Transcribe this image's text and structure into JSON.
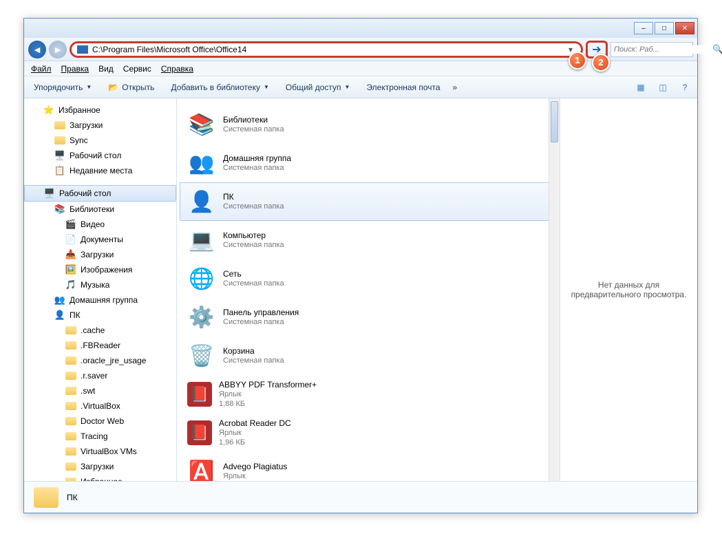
{
  "titlebar": {
    "min": "–",
    "max": "□",
    "close": "✕"
  },
  "address": {
    "path": "C:\\Program Files\\Microsoft Office\\Office14"
  },
  "callouts": {
    "one": "1",
    "two": "2"
  },
  "search": {
    "placeholder": "Поиск: Раб..."
  },
  "menu": {
    "file": "Файл",
    "edit": "Правка",
    "view": "Вид",
    "tools": "Сервис",
    "help": "Справка"
  },
  "toolbar": {
    "organize": "Упорядочить",
    "open": "Открыть",
    "addlib": "Добавить в библиотеку",
    "share": "Общий доступ",
    "email": "Электронная почта"
  },
  "nav": {
    "favorites": "Избранное",
    "downloads": "Загрузки",
    "sync": "Sync",
    "desktop_fav": "Рабочий стол",
    "recent": "Недавние места",
    "desktop": "Рабочий стол",
    "libraries": "Библиотеки",
    "video": "Видео",
    "documents": "Документы",
    "downloads_lib": "Загрузки",
    "images": "Изображения",
    "music": "Музыка",
    "homegroup": "Домашняя группа",
    "pc": "ПК",
    "cache": ".cache",
    "fbreader": ".FBReader",
    "oracle": ".oracle_jre_usage",
    "rsaver": ".r.saver",
    "swt": ".swt",
    "vbox": ".VirtualBox",
    "drweb": "Doctor Web",
    "tracing": "Tracing",
    "vboxvms": "VirtualBox VMs",
    "downloads2": "Загрузки",
    "favorites2": "Избранное"
  },
  "items": [
    {
      "name": "Библиотеки",
      "sub1": "Системная папка",
      "sub2": "",
      "icon": "libraries"
    },
    {
      "name": "Домашняя группа",
      "sub1": "Системная папка",
      "sub2": "",
      "icon": "homegroup"
    },
    {
      "name": "ПК",
      "sub1": "Системная папка",
      "sub2": "",
      "icon": "userfolder",
      "selected": true
    },
    {
      "name": "Компьютер",
      "sub1": "Системная папка",
      "sub2": "",
      "icon": "computer"
    },
    {
      "name": "Сеть",
      "sub1": "Системная папка",
      "sub2": "",
      "icon": "network"
    },
    {
      "name": "Панель управления",
      "sub1": "Системная папка",
      "sub2": "",
      "icon": "control"
    },
    {
      "name": "Корзина",
      "sub1": "Системная папка",
      "sub2": "",
      "icon": "recycle"
    },
    {
      "name": "ABBYY PDF Transformer+",
      "sub1": "Ярлык",
      "sub2": "1,88 КБ",
      "icon": "abbyy"
    },
    {
      "name": "Acrobat Reader DC",
      "sub1": "Ярлык",
      "sub2": "1,96 КБ",
      "icon": "acrobat"
    },
    {
      "name": "Advego Plagiatus",
      "sub1": "Ярлык",
      "sub2": "",
      "icon": "advego"
    }
  ],
  "preview": {
    "text": "Нет данных для предварительного просмотра."
  },
  "status": {
    "name": "ПК"
  }
}
